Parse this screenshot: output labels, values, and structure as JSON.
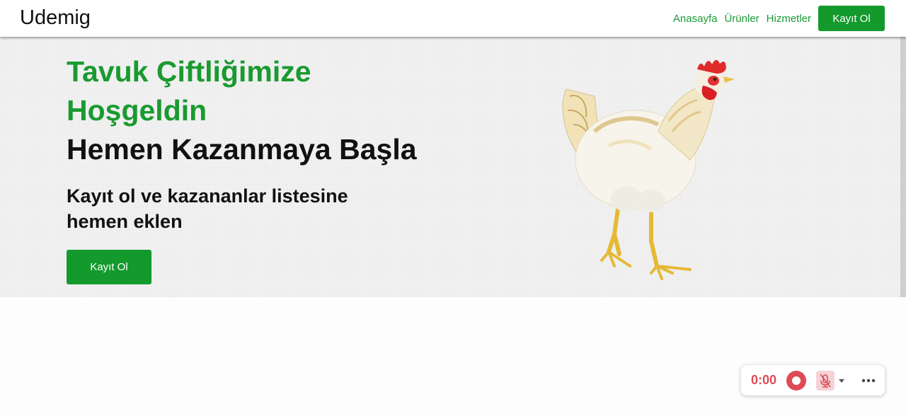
{
  "navbar": {
    "brand": "Udemig",
    "links": [
      "Anasayfa",
      "Ürünler",
      "Hizmetler"
    ],
    "signup_label": "Kayıt Ol"
  },
  "hero": {
    "title_green": "Tavuk Çiftliğimize Hoşgeldin",
    "title_black": "Hemen Kazanmaya Başla",
    "subtitle": "Kayıt ol ve kazananlar listesine hemen eklen",
    "button_label": "Kayıt Ol",
    "image": "chicken-illustration"
  },
  "recorder": {
    "time": "0:00",
    "icons": [
      "record-icon",
      "mic-muted-icon",
      "caret-down-icon",
      "more-icon"
    ]
  },
  "colors": {
    "brand_green": "#149a2c",
    "title_green": "#1a9a30",
    "record_red": "#e04a55"
  }
}
